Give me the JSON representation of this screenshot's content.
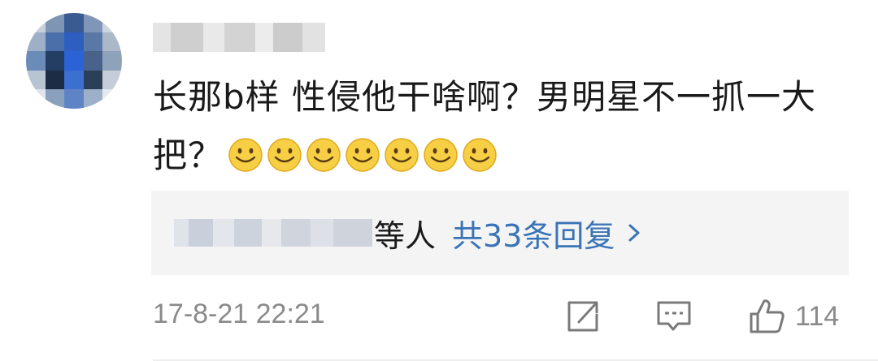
{
  "comment": {
    "text": "长那b样 性侵他干啥啊？男明星不一抓一大把？",
    "emoji_icon": "smiley-face-icon",
    "emoji_count": 7
  },
  "replies": {
    "others_text": "等人",
    "count_link": "共33条回复"
  },
  "footer": {
    "timestamp": "17-8-21 22:21",
    "like_count": "114"
  },
  "colors": {
    "link": "#3a74b6",
    "meta_gray": "#8a8a8a",
    "reply_bg": "#f4f4f4"
  }
}
